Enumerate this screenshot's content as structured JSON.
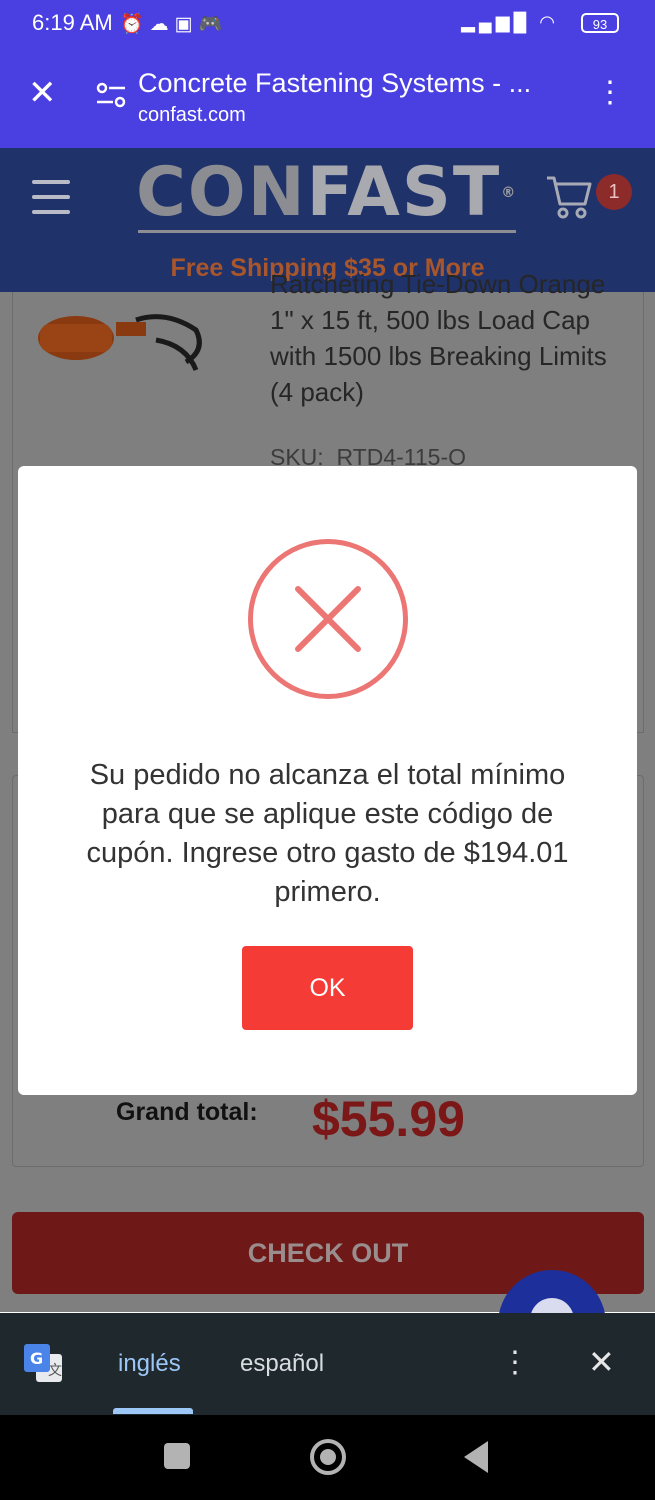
{
  "status_bar": {
    "time": "6:19 AM",
    "battery": "93",
    "icons": [
      "alarm-icon",
      "cloud-icon",
      "notification-icon",
      "game-icon",
      "signal-icon",
      "wifi-icon",
      "battery-icon"
    ]
  },
  "browser": {
    "page_title": "Concrete Fastening Systems - ...",
    "url": "confast.com"
  },
  "site_header": {
    "logo_con": "CON",
    "logo_fast": "FAST",
    "logo_reg": "®",
    "cart_count": "1",
    "promo": "Free Shipping $35 or More"
  },
  "cart_item": {
    "name": "Ratcheting Tie-Down Orange 1\" x 15 ft, 500 lbs Load Cap with 1500 lbs Breaking Limits (4 pack)",
    "sku_label": "SKU:",
    "sku_value": "RTD4-115-O"
  },
  "summary": {
    "grand_total_label": "Grand total:",
    "grand_total_value": "$55.99"
  },
  "checkout_button": "CHECK OUT",
  "modal": {
    "message": "Su pedido no alcanza el total mínimo para que se aplique este código de cupón. Ingrese otro gasto de $194.01 primero.",
    "ok_label": "OK"
  },
  "translate_bar": {
    "lang_source": "inglés",
    "lang_target": "español"
  },
  "colors": {
    "browser_bar": "#4a3fe0",
    "modal_error": "#ec7674",
    "ok_button": "#f43b35",
    "grand_total": "#7c1717"
  }
}
